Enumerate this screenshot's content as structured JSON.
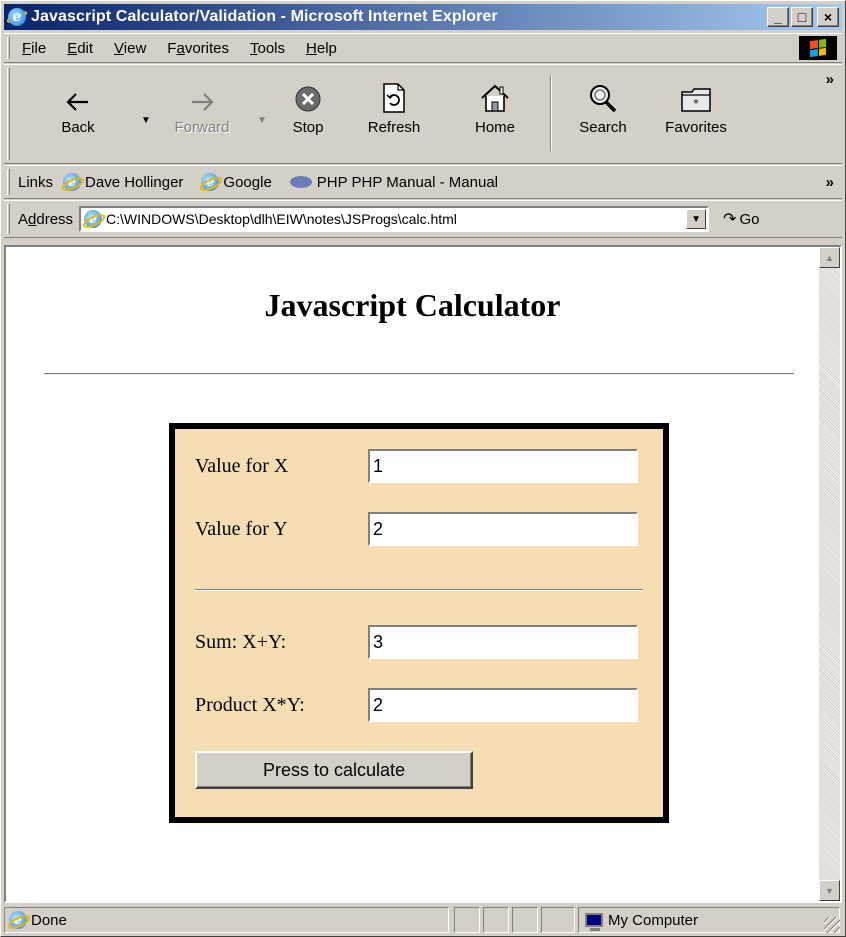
{
  "window": {
    "title": "Javascript Calculator/Validation - Microsoft Internet Explorer",
    "controls": {
      "minimize": "_",
      "maximize": "□",
      "close": "×"
    }
  },
  "menu": [
    {
      "pre": "",
      "key": "F",
      "post": "ile"
    },
    {
      "pre": "",
      "key": "E",
      "post": "dit"
    },
    {
      "pre": "",
      "key": "V",
      "post": "iew"
    },
    {
      "pre": "F",
      "key": "a",
      "post": "vorites"
    },
    {
      "pre": "",
      "key": "T",
      "post": "ools"
    },
    {
      "pre": "",
      "key": "H",
      "post": "elp"
    }
  ],
  "toolbar": {
    "back": "Back",
    "forward": "Forward",
    "stop": "Stop",
    "refresh": "Refresh",
    "home": "Home",
    "search": "Search",
    "favorites": "Favorites",
    "more": "»"
  },
  "links": {
    "label": "Links",
    "items": [
      "Dave Hollinger",
      "Google",
      "PHP PHP Manual - Manual"
    ],
    "more": "»"
  },
  "address": {
    "label_pre": "A",
    "label_key": "d",
    "label_post": "dress",
    "url": "C:\\WINDOWS\\Desktop\\dlh\\EIW\\notes\\JSProgs\\calc.html",
    "go": "Go"
  },
  "page": {
    "heading": "Javascript Calculator",
    "calculator": {
      "x_label": "Value for X",
      "x_value": "1",
      "y_label": "Value for Y",
      "y_value": "2",
      "sum_label": "Sum: X+Y:",
      "sum_value": "3",
      "product_label": "Product X*Y:",
      "product_value": "2",
      "button": "Press to calculate"
    },
    "colors": {
      "calc_background": "#f5deb3",
      "calc_border": "#000000"
    }
  },
  "status": {
    "text": "Done",
    "zone": "My Computer"
  },
  "icons": [
    "ie-icon",
    "back-arrow-icon",
    "forward-arrow-icon",
    "stop-icon",
    "refresh-icon",
    "home-icon",
    "search-icon",
    "favorites-icon",
    "windows-logo-icon",
    "php-icon",
    "go-arrow-icon",
    "computer-icon"
  ]
}
